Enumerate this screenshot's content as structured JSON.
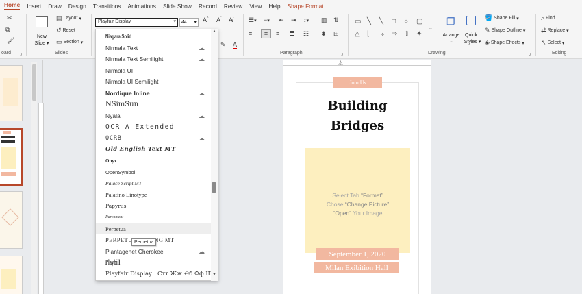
{
  "tabs": [
    {
      "label": "Home",
      "active": true
    },
    {
      "label": "Insert"
    },
    {
      "label": "Draw"
    },
    {
      "label": "Design"
    },
    {
      "label": "Transitions"
    },
    {
      "label": "Animations"
    },
    {
      "label": "Slide Show"
    },
    {
      "label": "Record"
    },
    {
      "label": "Review"
    },
    {
      "label": "View"
    },
    {
      "label": "Help"
    },
    {
      "label": "Shape Format",
      "accent": true
    }
  ],
  "ribbon": {
    "slides": {
      "new_slide_1": "New",
      "new_slide_2": "Slide",
      "layout": "Layout",
      "reset": "Reset",
      "section": "Section",
      "group_label": "Slides"
    },
    "clipboard_label": "oard",
    "font": {
      "name": "Playfair Display",
      "size": "44"
    },
    "paragraph_label": "Paragraph",
    "drawing": {
      "arrange": "Arrange",
      "quick_1": "Quick",
      "quick_2": "Styles",
      "shape_fill": "Shape Fill",
      "shape_outline": "Shape Outline",
      "shape_effects": "Shape Effects",
      "group_label": "Drawing"
    },
    "editing": {
      "find": "Find",
      "replace": "Replace",
      "select": "Select",
      "group_label": "Editing"
    }
  },
  "font_list": [
    {
      "name": "Niagara Solid",
      "cloud": false
    },
    {
      "name": "Nirmala Text",
      "cloud": true
    },
    {
      "name": "Nirmala Text Semilight",
      "cloud": true
    },
    {
      "name": "Nirmala UI",
      "cloud": false
    },
    {
      "name": "Nirmala UI Semilight",
      "cloud": false
    },
    {
      "name": "Nordique Inline",
      "cloud": true
    },
    {
      "name": "NSimSun",
      "cloud": false
    },
    {
      "name": "Nyala",
      "cloud": true
    },
    {
      "name": "OCR A Extended",
      "cloud": false
    },
    {
      "name": "OCRB",
      "cloud": true
    },
    {
      "name": "Old English Text MT",
      "cloud": false
    },
    {
      "name": "Onyx",
      "cloud": false
    },
    {
      "name": "OpenSymbol",
      "cloud": false
    },
    {
      "name": "Palace Script MT",
      "cloud": false
    },
    {
      "name": "Palatino Linotype",
      "cloud": false
    },
    {
      "name": "Papyrus",
      "cloud": false
    },
    {
      "name": "Parchment",
      "cloud": false
    },
    {
      "name": "Perpetua",
      "cloud": false,
      "hover": true
    },
    {
      "name": "PERPETUA TITLING MT",
      "cloud": false
    },
    {
      "name": "Plantagenet Cherokee",
      "cloud": true
    },
    {
      "name": "Playbill",
      "cloud": false
    },
    {
      "name": "Playfair Display",
      "cloud": false,
      "sample": "Стт Жж Ҽб Фф Шш"
    }
  ],
  "tooltip": "Perpetua",
  "slide": {
    "badge": "Join Us",
    "title_line1": "Building",
    "title_line2": "Bridges",
    "picture_line1_pre": "Select Tab ",
    "picture_line1_em": "“Format”",
    "picture_line2_pre": "Chose ",
    "picture_line2_em": "“Change Picture”",
    "picture_line3_em": "“Open”",
    "picture_line3_post": " Your Image",
    "date": "September 1, 2020",
    "venue": "Milan Exibition Hall"
  },
  "colors": {
    "accent": "#b7472a",
    "badge": "#f2b8a0",
    "picture": "#fdefbf"
  }
}
